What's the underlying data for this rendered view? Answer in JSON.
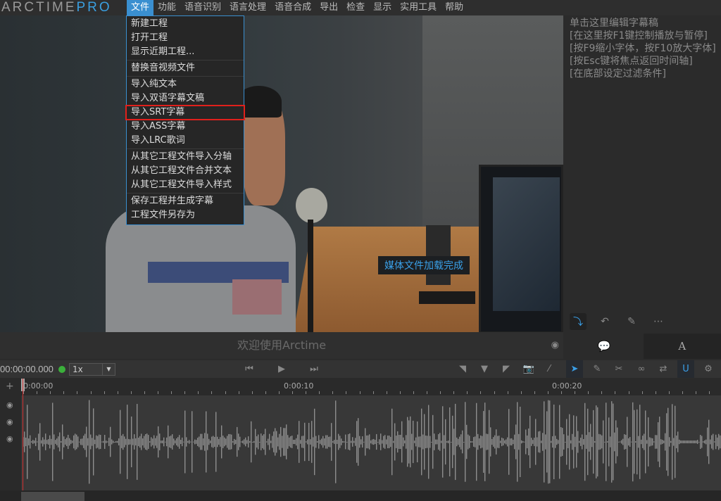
{
  "app": {
    "logo_main": "ARCTIME",
    "logo_pro": "PRO"
  },
  "menu": [
    "文件",
    "功能",
    "语音识别",
    "语言处理",
    "语音合成",
    "导出",
    "检查",
    "显示",
    "实用工具",
    "帮助"
  ],
  "file_menu": {
    "groups": [
      [
        "新建工程",
        "打开工程",
        "显示近期工程..."
      ],
      [
        "替换音视频文件"
      ],
      [
        "导入纯文本",
        "导入双语字幕文稿",
        "导入SRT字幕",
        "导入ASS字幕",
        "导入LRC歌词"
      ],
      [
        "从其它工程文件导入分轴",
        "从其它工程文件合并文本",
        "从其它工程文件导入样式"
      ],
      [
        "保存工程并生成字幕",
        "工程文件另存为"
      ]
    ],
    "highlighted": "导入SRT字幕"
  },
  "video": {
    "toast": "媒体文件加载完成"
  },
  "subtitle_bar": {
    "text": "欢迎使用Arctime"
  },
  "editor": {
    "lines": [
      "单击这里编辑字幕稿",
      "[在这里按F1键控制播放与暂停]",
      "[按F9缩小字体，按F10放大字体]",
      "[按Esc键将焦点返回时间轴]",
      "[在底部设定过滤条件]"
    ]
  },
  "right_tabs": {
    "a": "A"
  },
  "transport": {
    "time": "00:00:00.000",
    "speed": "1x"
  },
  "ruler": {
    "labels": [
      "0:00:00",
      "0:00:10",
      "0:00:20"
    ]
  },
  "colors": {
    "accent": "#3a9fe0",
    "highlight": "#e0201c",
    "status": "#3bb03b"
  }
}
